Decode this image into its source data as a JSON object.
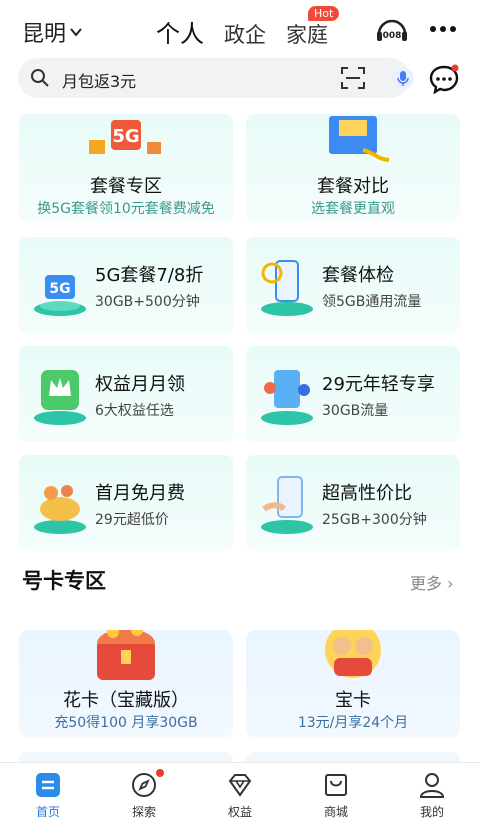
{
  "header": {
    "city": "昆明",
    "tabs": [
      "个人",
      "政企",
      "家庭"
    ],
    "hot_badge": "Hot",
    "service_number": "10086"
  },
  "search": {
    "query": "月包返3元"
  },
  "top_cards": [
    {
      "title": "套餐专区",
      "subtitle": "换5G套餐领10元套餐费减免",
      "icon": "5g-gift-icon"
    },
    {
      "title": "套餐对比",
      "subtitle": "选套餐更直观",
      "icon": "compare-box-icon"
    }
  ],
  "grid_cards": [
    {
      "title": "5G套餐7/8折",
      "subtitle": "30GB+500分钟",
      "icon": "5g-signal-icon"
    },
    {
      "title": "套餐体检",
      "subtitle": "领5GB通用流量",
      "icon": "phone-check-icon"
    },
    {
      "title": "权益月月领",
      "subtitle": "6大权益任选",
      "icon": "crown-icon"
    },
    {
      "title": "29元年轻专享",
      "subtitle": "30GB流量",
      "icon": "young-people-icon"
    },
    {
      "title": "首月免月费",
      "subtitle": "29元超低价",
      "icon": "gift-basket-icon"
    },
    {
      "title": "超高性价比",
      "subtitle": "25GB+300分钟",
      "icon": "phone-hand-icon"
    }
  ],
  "section": {
    "title": "号卡专区",
    "more": "更多 ›"
  },
  "number_cards": [
    {
      "title": "花卡（宝藏版）",
      "subtitle": "充50得100 月享30GB",
      "icon": "treasure-chest-icon"
    },
    {
      "title": "宝卡",
      "subtitle": "13元/月享24个月",
      "icon": "family-celebrate-icon"
    }
  ],
  "bottom_nav": [
    {
      "label": "首页",
      "icon": "home-icon",
      "active": true
    },
    {
      "label": "探索",
      "icon": "compass-icon",
      "active": false
    },
    {
      "label": "权益",
      "icon": "diamond-icon",
      "active": false
    },
    {
      "label": "商城",
      "icon": "shopping-bag-icon",
      "active": false
    },
    {
      "label": "我的",
      "icon": "user-icon",
      "active": false
    }
  ],
  "colors": {
    "accent": "#1e7fe0",
    "hot_red": "#ef4a3a",
    "card_green": "#e8fbf8",
    "card_blue": "#eaf5ff"
  }
}
